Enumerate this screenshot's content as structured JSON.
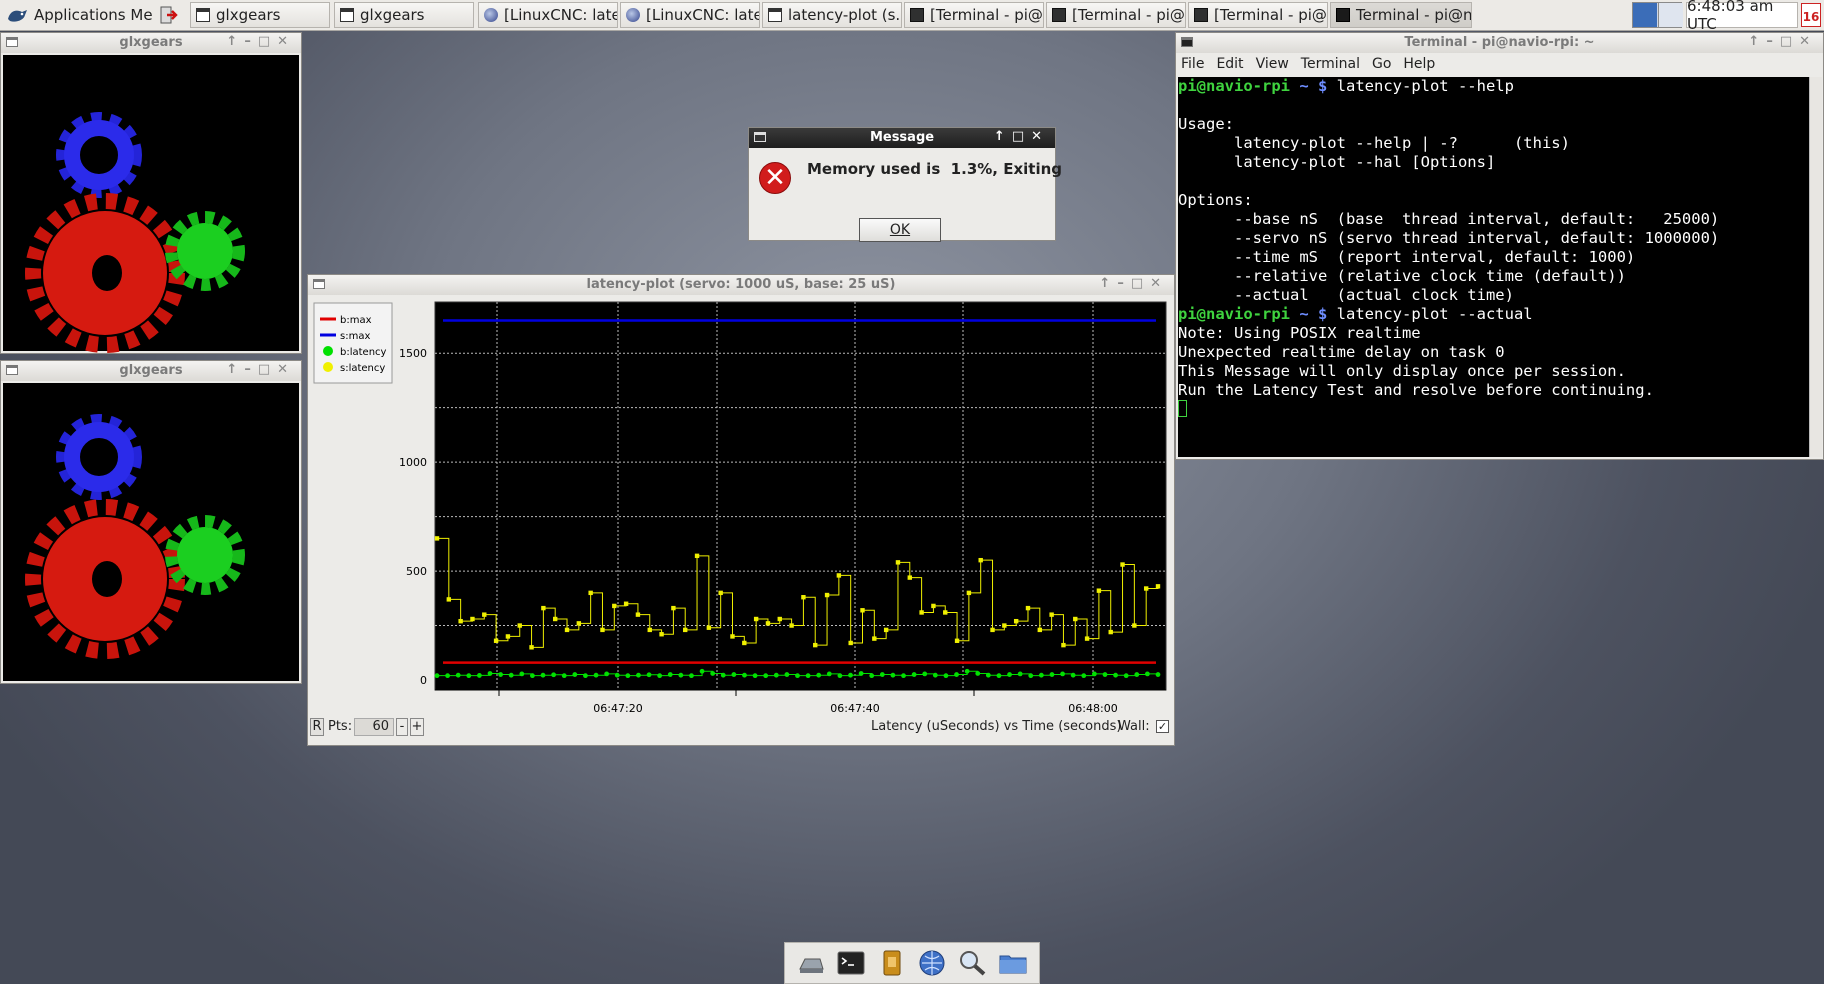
{
  "taskbar": {
    "apps_menu": "Applications Menu",
    "tasks": [
      {
        "label": "glxgears",
        "icon": "window-icon"
      },
      {
        "label": "glxgears",
        "icon": "window-icon"
      },
      {
        "label": "[LinuxCNC: late...",
        "icon": "linuxcnc-icon"
      },
      {
        "label": "[LinuxCNC: late...",
        "icon": "linuxcnc-icon"
      },
      {
        "label": "latency-plot (s...",
        "icon": "window-icon"
      },
      {
        "label": "[Terminal - pi@...",
        "icon": "terminal-icon"
      },
      {
        "label": "[Terminal - pi@...",
        "icon": "terminal-icon"
      },
      {
        "label": "[Terminal - pi@...",
        "icon": "terminal-icon"
      },
      {
        "label": "Terminal - pi@n...",
        "icon": "terminal-icon"
      }
    ],
    "clock": "6:48:03 am UTC",
    "calendar_day": "16"
  },
  "glx1": {
    "title": "glxgears"
  },
  "glx2": {
    "title": "glxgears"
  },
  "message": {
    "title": "Message",
    "text": "Memory used is  1.3%, Exiting",
    "ok": "OK"
  },
  "latency": {
    "title": "latency-plot (servo: 1000 uS, base: 25 uS)",
    "legend": [
      {
        "label": "b:max",
        "color": "#e00000"
      },
      {
        "label": "s:max",
        "color": "#0000e0"
      },
      {
        "label": "b:latency",
        "color": "#00e000"
      },
      {
        "label": "s:latency",
        "color": "#f0f000"
      }
    ],
    "r_button": "R",
    "pts_label": "Pts:",
    "pts_value": "60",
    "minus": "-",
    "plus": "+",
    "axis_caption": "Latency (uSeconds) vs Time (seconds)",
    "wall_label": "Wall:",
    "wall_checked": true
  },
  "chart_data": {
    "type": "line",
    "ylabel": "",
    "xlabel": "Latency (uSeconds) vs Time (seconds)",
    "ylim": [
      0,
      1680
    ],
    "y_ticks": [
      "0",
      "500",
      "1000",
      "1500"
    ],
    "x_ticks": [
      "06:47:20",
      "06:47:40",
      "06:48:00"
    ],
    "grid": true,
    "series": [
      {
        "name": "b:max",
        "color": "#e00000",
        "values": [
          80
        ]
      },
      {
        "name": "s:max",
        "color": "#0000e0",
        "values": [
          1650
        ]
      },
      {
        "name": "b:latency",
        "color": "#00e000",
        "values": [
          20,
          20,
          22,
          20,
          21,
          30,
          25,
          22,
          28,
          20,
          22,
          24,
          20,
          25,
          20,
          22,
          28,
          22,
          20,
          22,
          24,
          20,
          25,
          22,
          20,
          40,
          30,
          22,
          25,
          22,
          20,
          20,
          22,
          25,
          20,
          20,
          22,
          28,
          20,
          22,
          30,
          20,
          25,
          22,
          20,
          25,
          28,
          22,
          20,
          25,
          40,
          30,
          22,
          20,
          25,
          28,
          20,
          22,
          25,
          28,
          22,
          20,
          28,
          25,
          22,
          20,
          25,
          28,
          25
        ]
      },
      {
        "name": "s:latency",
        "color": "#f0f000",
        "values": [
          650,
          370,
          270,
          280,
          300,
          180,
          200,
          250,
          150,
          330,
          280,
          230,
          260,
          400,
          230,
          340,
          350,
          300,
          230,
          210,
          330,
          230,
          570,
          240,
          400,
          200,
          170,
          280,
          260,
          280,
          250,
          380,
          160,
          390,
          480,
          170,
          320,
          190,
          230,
          540,
          470,
          310,
          340,
          310,
          180,
          400,
          550,
          230,
          250,
          270,
          330,
          230,
          300,
          160,
          280,
          190,
          410,
          220,
          530,
          250,
          420,
          430
        ]
      }
    ]
  },
  "terminal": {
    "title": "Terminal - pi@navio-rpi: ~",
    "menu": [
      "File",
      "Edit",
      "View",
      "Terminal",
      "Go",
      "Help"
    ],
    "prompt": "pi@navio-rpi",
    "path": " ~ ",
    "dollar": "$",
    "cmd1": " latency-plot --help",
    "output1": "\nUsage:\n      latency-plot --help | -?      (this)\n      latency-plot --hal [Options]\n\nOptions:\n      --base nS  (base  thread interval, default:   25000)\n      --servo nS (servo thread interval, default: 1000000)\n      --time mS  (report interval, default: 1000)\n      --relative (relative clock time (default))\n      --actual   (actual clock time)",
    "cmd2": " latency-plot --actual",
    "output2": "Note: Using POSIX realtime\nUnexpected realtime delay on task 0\nThis Message will only display once per session.\nRun the Latency Test and resolve before continuing."
  }
}
